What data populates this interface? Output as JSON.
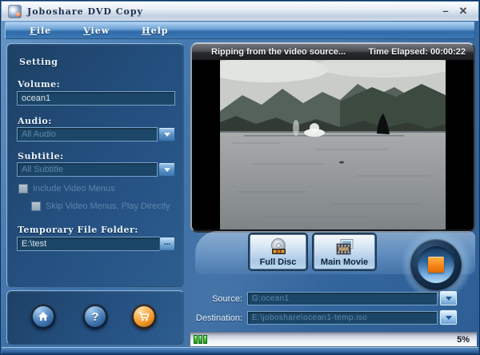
{
  "window": {
    "title": "Joboshare DVD Copy",
    "minimize_glyph": "–",
    "close_glyph": "✕"
  },
  "menu": {
    "items": [
      "File",
      "View",
      "Help"
    ]
  },
  "settings": {
    "heading": "Setting",
    "volume": {
      "label": "Volume:",
      "value": "ocean1"
    },
    "audio": {
      "label": "Audio:",
      "value": "All Audio"
    },
    "subtitle": {
      "label": "Subtitle:",
      "value": "All Subtitle"
    },
    "include_video_menus": "Include Video Menus",
    "skip_video_menus": "Skip Video Menus, Play Directly",
    "temp_folder": {
      "label": "Temporary File Folder:",
      "value": "E:\\test",
      "browse": "..."
    }
  },
  "preview": {
    "status": "Ripping from the video source...",
    "time": "Time Elapsed: 00:00:22"
  },
  "modes": {
    "full_disc": "Full Disc",
    "main_movie": "Main Movie"
  },
  "io": {
    "source": {
      "label": "Source:",
      "value": "G:ocean1"
    },
    "destination": {
      "label": "Destination:",
      "value": "E:\\joboshare\\ocean1-temp.iso"
    }
  },
  "statusbar": {
    "percent": "5%"
  },
  "icons": {
    "help_glyph": "?"
  },
  "colors": {
    "accent_orange": "#F68617",
    "progress_green": "#46C832",
    "panel_navy": "#1D4165",
    "disabled_text": "#5F86A8"
  }
}
